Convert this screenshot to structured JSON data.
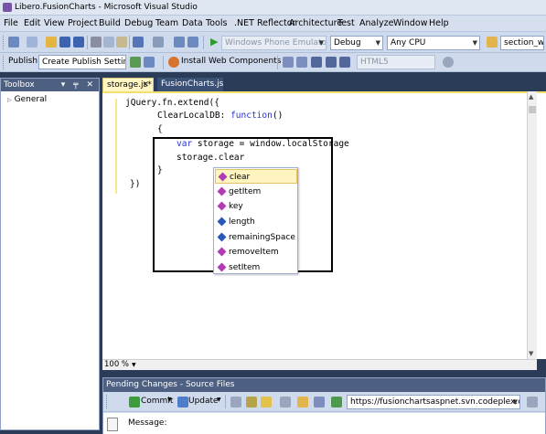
{
  "window": {
    "title": "Libero.FusionCharts - Microsoft Visual Studio"
  },
  "menu": [
    "File",
    "Edit",
    "View",
    "Project",
    "Build",
    "Debug",
    "Team",
    "Data",
    "Tools",
    ".NET Reflector",
    "Architecture",
    "Test",
    "Analyze",
    "Window",
    "Help"
  ],
  "toolbar1": {
    "emulator_combo": "Windows Phone Emulator",
    "config_combo": "Debug",
    "platform_combo": "Any CPU",
    "find_combo": "section_w"
  },
  "toolbar2": {
    "publish_label": "Publish:",
    "publish_combo": "Create Publish Settings",
    "install_web_components": "Install Web Components",
    "html_version_combo": "HTML5"
  },
  "toolbox": {
    "title": "Toolbox",
    "pin_icons": "▾ ╤ ✕",
    "group": "General"
  },
  "tabs": [
    {
      "label": "storage.js*",
      "active": true
    },
    {
      "label": "FusionCharts.js",
      "active": false
    }
  ],
  "editor": {
    "lines": {
      "l1": "jQuery.fn.extend({",
      "l2a": "ClearLocalDB: ",
      "l2b": "function",
      "l2c": "()",
      "l3": "{",
      "l4a": "var",
      "l4b": " storage = window.localStorage",
      "l5": "storage.clear",
      "l6": "}",
      "l7": "})"
    },
    "zoom": "100 %"
  },
  "intellisense": {
    "items": [
      {
        "label": "clear",
        "kind": "method",
        "selected": true
      },
      {
        "label": "getItem",
        "kind": "method",
        "selected": false
      },
      {
        "label": "key",
        "kind": "method",
        "selected": false
      },
      {
        "label": "length",
        "kind": "property",
        "selected": false
      },
      {
        "label": "remainingSpace",
        "kind": "property",
        "selected": false
      },
      {
        "label": "removeItem",
        "kind": "method",
        "selected": false
      },
      {
        "label": "setItem",
        "kind": "method",
        "selected": false
      }
    ]
  },
  "pending_changes": {
    "title": "Pending Changes - Source Files",
    "commit_label": "Commit",
    "update_label": "Update",
    "url_combo": "https://fusionchartsaspnet.svn.codeplex.com/sv",
    "message_label": "Message:"
  },
  "colors": {
    "panel_header": "#4d6082",
    "active_tab": "#fff6c3",
    "keyword": "#2a33d6",
    "method_icon": "#b23ab3",
    "property_icon": "#2a58b8"
  }
}
